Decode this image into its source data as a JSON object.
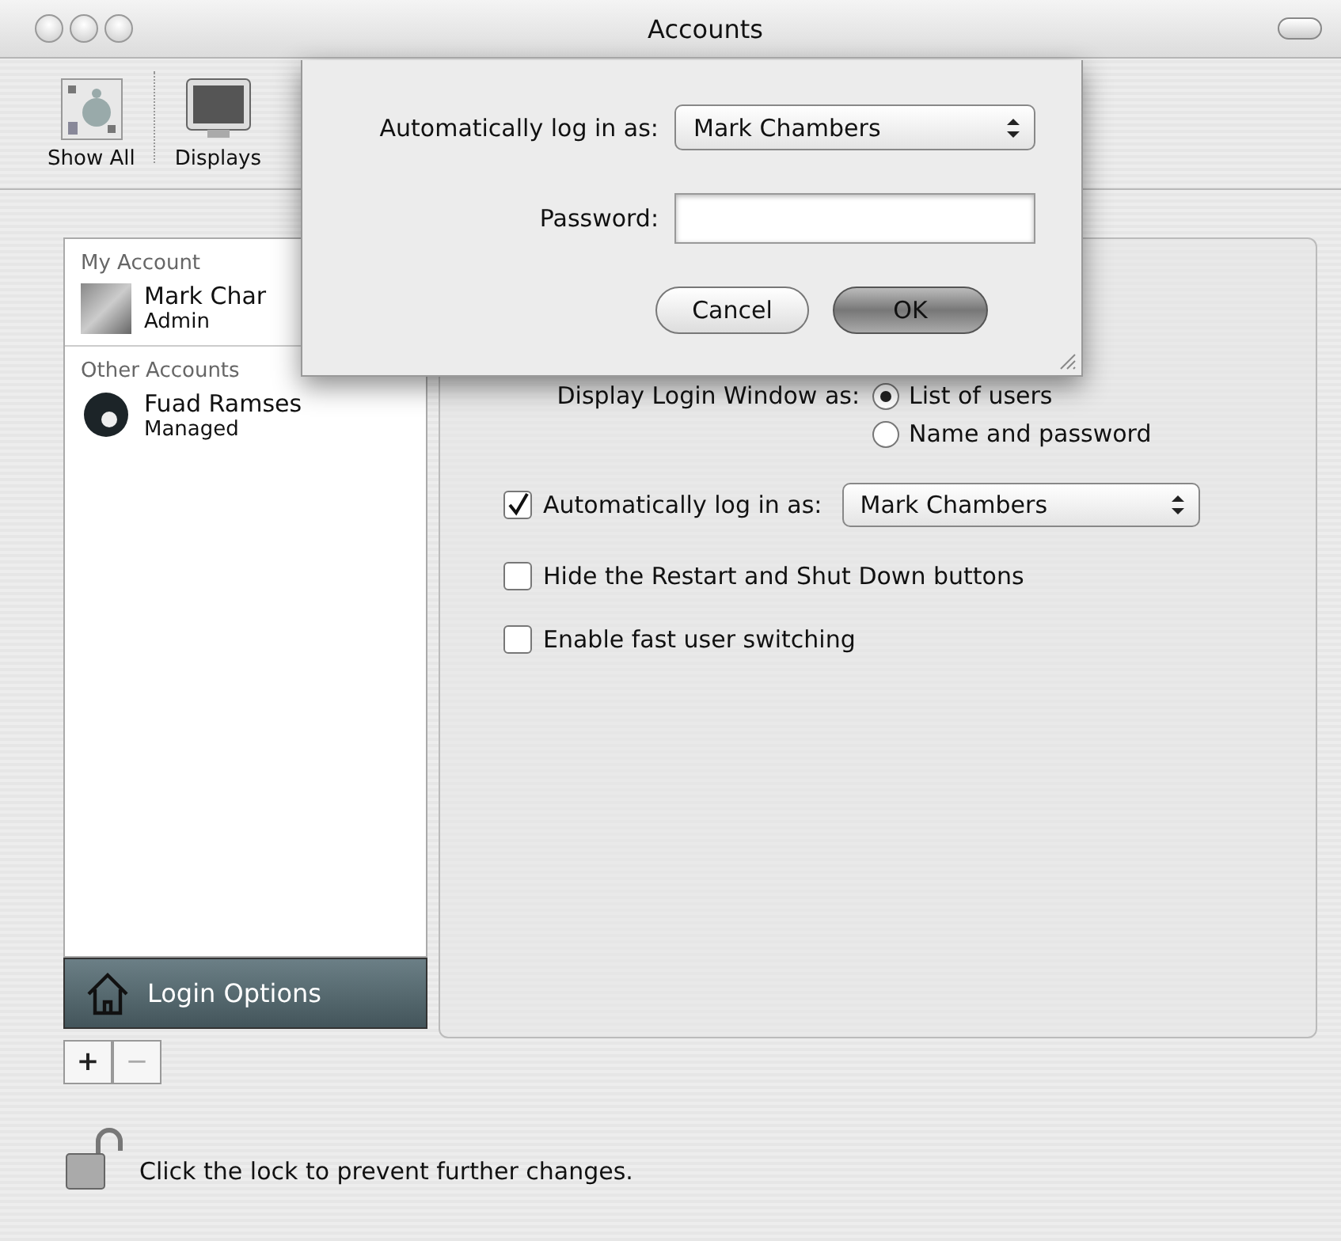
{
  "window": {
    "title": "Accounts"
  },
  "toolbar": {
    "items": [
      {
        "label": "Show All",
        "kind": "grid"
      },
      {
        "label": "Displays",
        "kind": "monitor"
      }
    ]
  },
  "sidebar": {
    "groups": [
      {
        "heading": "My Account",
        "accounts": [
          {
            "name": "Mark Char",
            "role": "Admin",
            "selected": false,
            "kind": "photo"
          }
        ]
      },
      {
        "heading": "Other Accounts",
        "accounts": [
          {
            "name": "Fuad Ramses",
            "role": "Managed",
            "selected": false,
            "kind": "ball"
          }
        ]
      }
    ],
    "login_options": {
      "label": "Login Options",
      "selected": true
    },
    "buttons": [
      {
        "label": "+",
        "disabled": false
      },
      {
        "label": "−",
        "disabled": true
      }
    ]
  },
  "panel": {
    "display_login_label": "Display Login Window as:",
    "radios": [
      {
        "label": "List of users",
        "selected": true
      },
      {
        "label": "Name and password",
        "selected": false
      }
    ],
    "options": [
      {
        "kind": "popup",
        "label": "Automatically log in as:",
        "checked": true,
        "value": "Mark Chambers"
      },
      {
        "kind": "check",
        "label": "Hide the Restart and Shut Down buttons",
        "checked": false
      },
      {
        "kind": "check",
        "label": "Enable fast user switching",
        "checked": false
      }
    ]
  },
  "lock": {
    "text": "Click the lock to prevent further changes.",
    "locked": false
  },
  "sheet": {
    "login_label": "Automatically log in as:",
    "user": "Mark Chambers",
    "password_label": "Password:",
    "buttons": [
      {
        "label": "Cancel",
        "default": false
      },
      {
        "label": "OK",
        "default": true
      }
    ]
  }
}
